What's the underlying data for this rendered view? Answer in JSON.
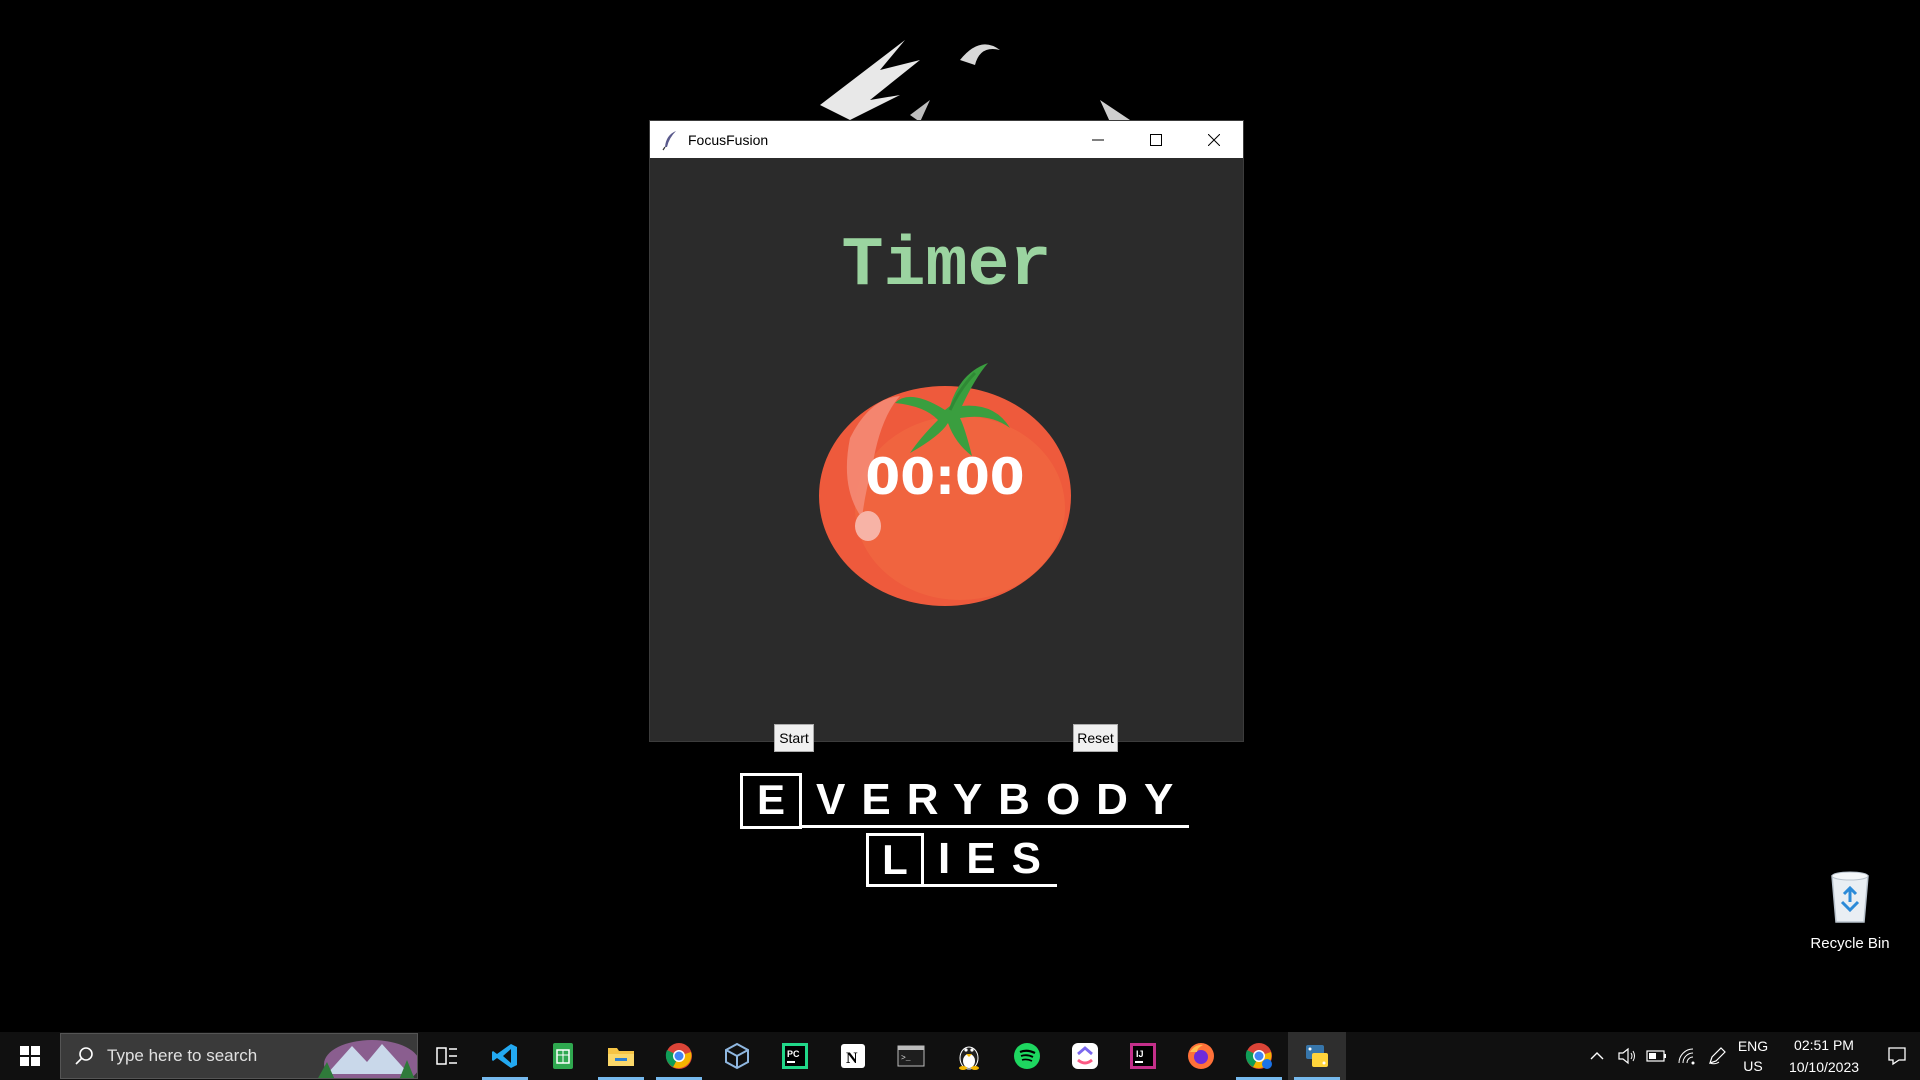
{
  "window": {
    "title": "FocusFusion",
    "heading": "Timer",
    "clock": "00:00",
    "start_label": "Start",
    "reset_label": "Reset"
  },
  "desktop": {
    "logo_first": "E",
    "logo_rest": "VERYBODY",
    "logo_second": "L",
    "logo_rest2": "IES",
    "recycle_bin_label": "Recycle Bin"
  },
  "taskbar": {
    "search_placeholder": "Type here to search",
    "apps": [
      "task-view-icon",
      "vscode-icon",
      "sheets-icon",
      "file-explorer-icon",
      "chrome-icon",
      "virtualbox-icon",
      "pycharm-icon",
      "notion-icon",
      "terminal-icon",
      "linux-icon",
      "spotify-icon",
      "clickup-icon",
      "intellij-icon",
      "firefox-icon",
      "chrome-profile-icon",
      "python-icon"
    ],
    "lang_line1": "ENG",
    "lang_line2": "US",
    "time": "02:51 PM",
    "date": "10/10/2023"
  },
  "colors": {
    "window_bg": "#2b2b2b",
    "heading": "#9bd4a0",
    "tomato": "#ee5a3c",
    "leaf": "#3a9e3f",
    "taskbar": "#101010",
    "active_indicator": "#76b9ed"
  }
}
